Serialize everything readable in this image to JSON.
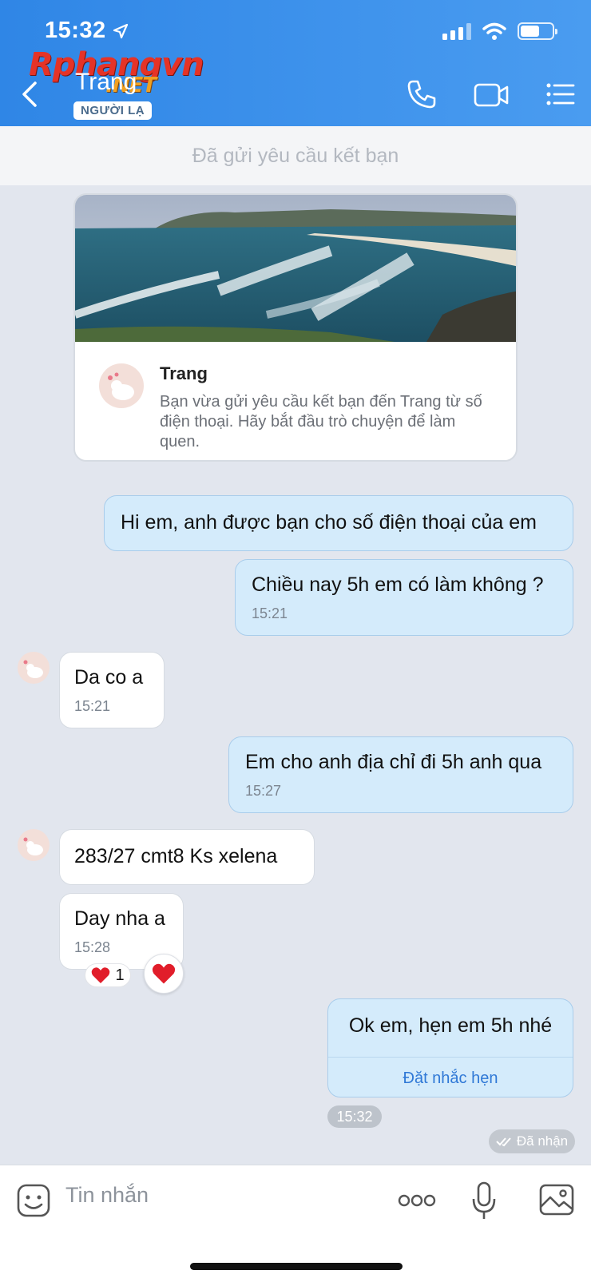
{
  "status_bar": {
    "time": "15:32"
  },
  "header": {
    "contact_name": "Trang",
    "badge": "NGƯỜI LẠ",
    "watermark_main": "Rphangvn",
    "watermark_sub": ".NET",
    "icons": [
      "back-icon",
      "phone-icon",
      "video-call-icon",
      "menu-list-icon"
    ]
  },
  "banner": {
    "text": "Đã gửi yêu cầu kết bạn"
  },
  "friend_card": {
    "name": "Trang",
    "description": "Bạn vừa gửi yêu cầu kết bạn đến Trang từ số điện thoại. Hãy bắt đầu trò chuyện để làm quen."
  },
  "messages": [
    {
      "direction": "out",
      "text": "Hi em, anh được bạn cho số điện thoại của em"
    },
    {
      "direction": "out",
      "text": "Chiều nay 5h em có làm không ?",
      "time": "15:21"
    },
    {
      "direction": "in",
      "text": "Da co a",
      "time": "15:21"
    },
    {
      "direction": "out",
      "text": "Em cho anh địa chỉ đi 5h anh qua",
      "time": "15:27"
    },
    {
      "direction": "in",
      "text": "283/27 cmt8 Ks xelena"
    },
    {
      "direction": "in",
      "text": "Day nha a",
      "time": "15:28"
    },
    {
      "direction": "out",
      "text": "Ok em, hẹn em 5h nhé",
      "action": "Đặt nhắc hẹn"
    }
  ],
  "reaction": {
    "emoji": "❤️",
    "count": "1"
  },
  "last_time_chip": "15:32",
  "delivery_status": "Đã nhận",
  "input": {
    "placeholder": "Tin nhắn"
  },
  "colors": {
    "header": "#3a8ff0",
    "out_bubble": "#d4ebfb",
    "in_bubble": "#ffffff",
    "link": "#2f78d6",
    "heart": "#e11d2a"
  }
}
